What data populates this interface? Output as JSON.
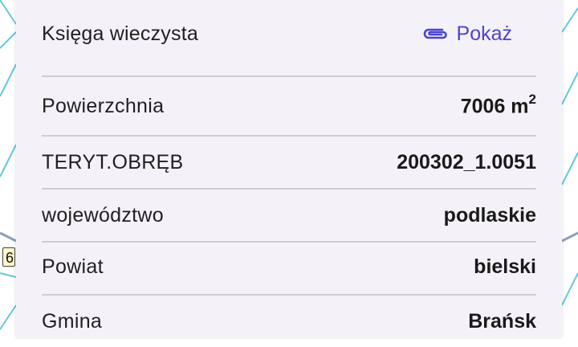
{
  "map": {
    "road_number": "6"
  },
  "sheet": {
    "ksiega": {
      "label": "Księga wieczysta",
      "action_label": "Pokaż",
      "action_icon": "paperclip-icon",
      "action_color": "#4a44d6"
    },
    "rows": [
      {
        "label": "Powierzchnia",
        "value": "7006 m",
        "value_sup": "2"
      },
      {
        "label": "TERYT.OBRĘB",
        "value": "200302_1.0051"
      },
      {
        "label": "województwo",
        "value": "podlaskie"
      },
      {
        "label": "Powiat",
        "value": "bielski"
      },
      {
        "label": "Gmina",
        "value": "Brańsk"
      }
    ]
  }
}
